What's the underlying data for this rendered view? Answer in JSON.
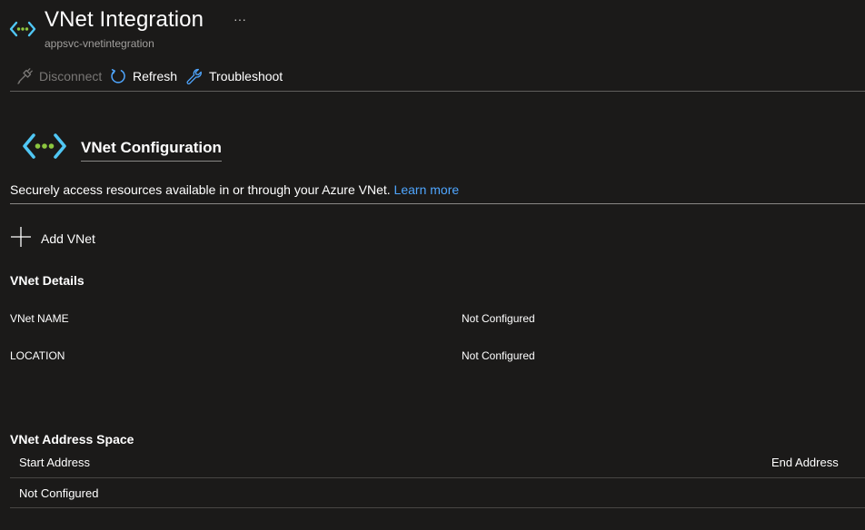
{
  "header": {
    "title": "VNet Integration",
    "subtitle": "appsvc-vnetintegration",
    "more_label": "···",
    "icon": "vnet-icon",
    "icon_colors": {
      "brackets": "#50c7f4",
      "dots": "#8cc63f"
    }
  },
  "toolbar": {
    "disconnect_label": "Disconnect",
    "refresh_label": "Refresh",
    "troubleshoot_label": "Troubleshoot"
  },
  "section": {
    "title": "VNet Configuration",
    "description": "Securely access resources available in or through your Azure VNet.",
    "learn_more": "Learn more",
    "add_vnet_label": "Add VNet"
  },
  "vnet_details": {
    "heading": "VNet Details",
    "rows": [
      {
        "label": "VNet NAME",
        "value": "Not Configured"
      },
      {
        "label": "LOCATION",
        "value": "Not Configured"
      }
    ]
  },
  "address_space": {
    "heading": "VNet Address Space",
    "columns": [
      "Start Address",
      "End Address"
    ],
    "rows": [
      {
        "start": "Not Configured",
        "end": ""
      }
    ]
  },
  "colors": {
    "background": "#1b1a19",
    "link": "#4fa6ff",
    "accent": "#0078d4",
    "disabled": "#797775"
  }
}
